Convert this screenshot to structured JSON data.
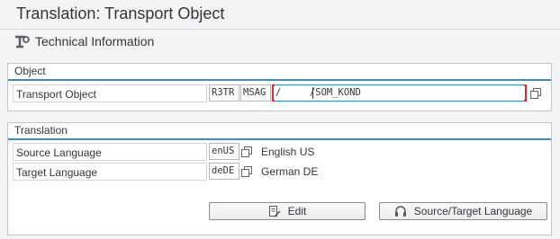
{
  "window": {
    "title": "Translation: Transport Object"
  },
  "toolbar": {
    "technical_info_label": "Technical Information",
    "icon": "technical-info-icon"
  },
  "object_group": {
    "title": "Object",
    "transport_object_label": "Transport Object",
    "pgmid": "R3TR",
    "object_type": "MSAG",
    "object_name": "/     /SOM_KOND"
  },
  "translation_group": {
    "title": "Translation",
    "source_language_label": "Source Language",
    "source_language_code": "enUS",
    "source_language_text": "English US",
    "target_language_label": "Target Language",
    "target_language_code": "deDE",
    "target_language_text": "German DE"
  },
  "buttons": {
    "edit_label": "Edit",
    "edit_icon": "edit-icon",
    "source_target_label": "Source/Target Language",
    "source_target_icon": "headset-icon"
  },
  "colors": {
    "accent": "#3f8fb5",
    "focus": "#2e8fd6",
    "required_bracket": "#c8352c"
  }
}
